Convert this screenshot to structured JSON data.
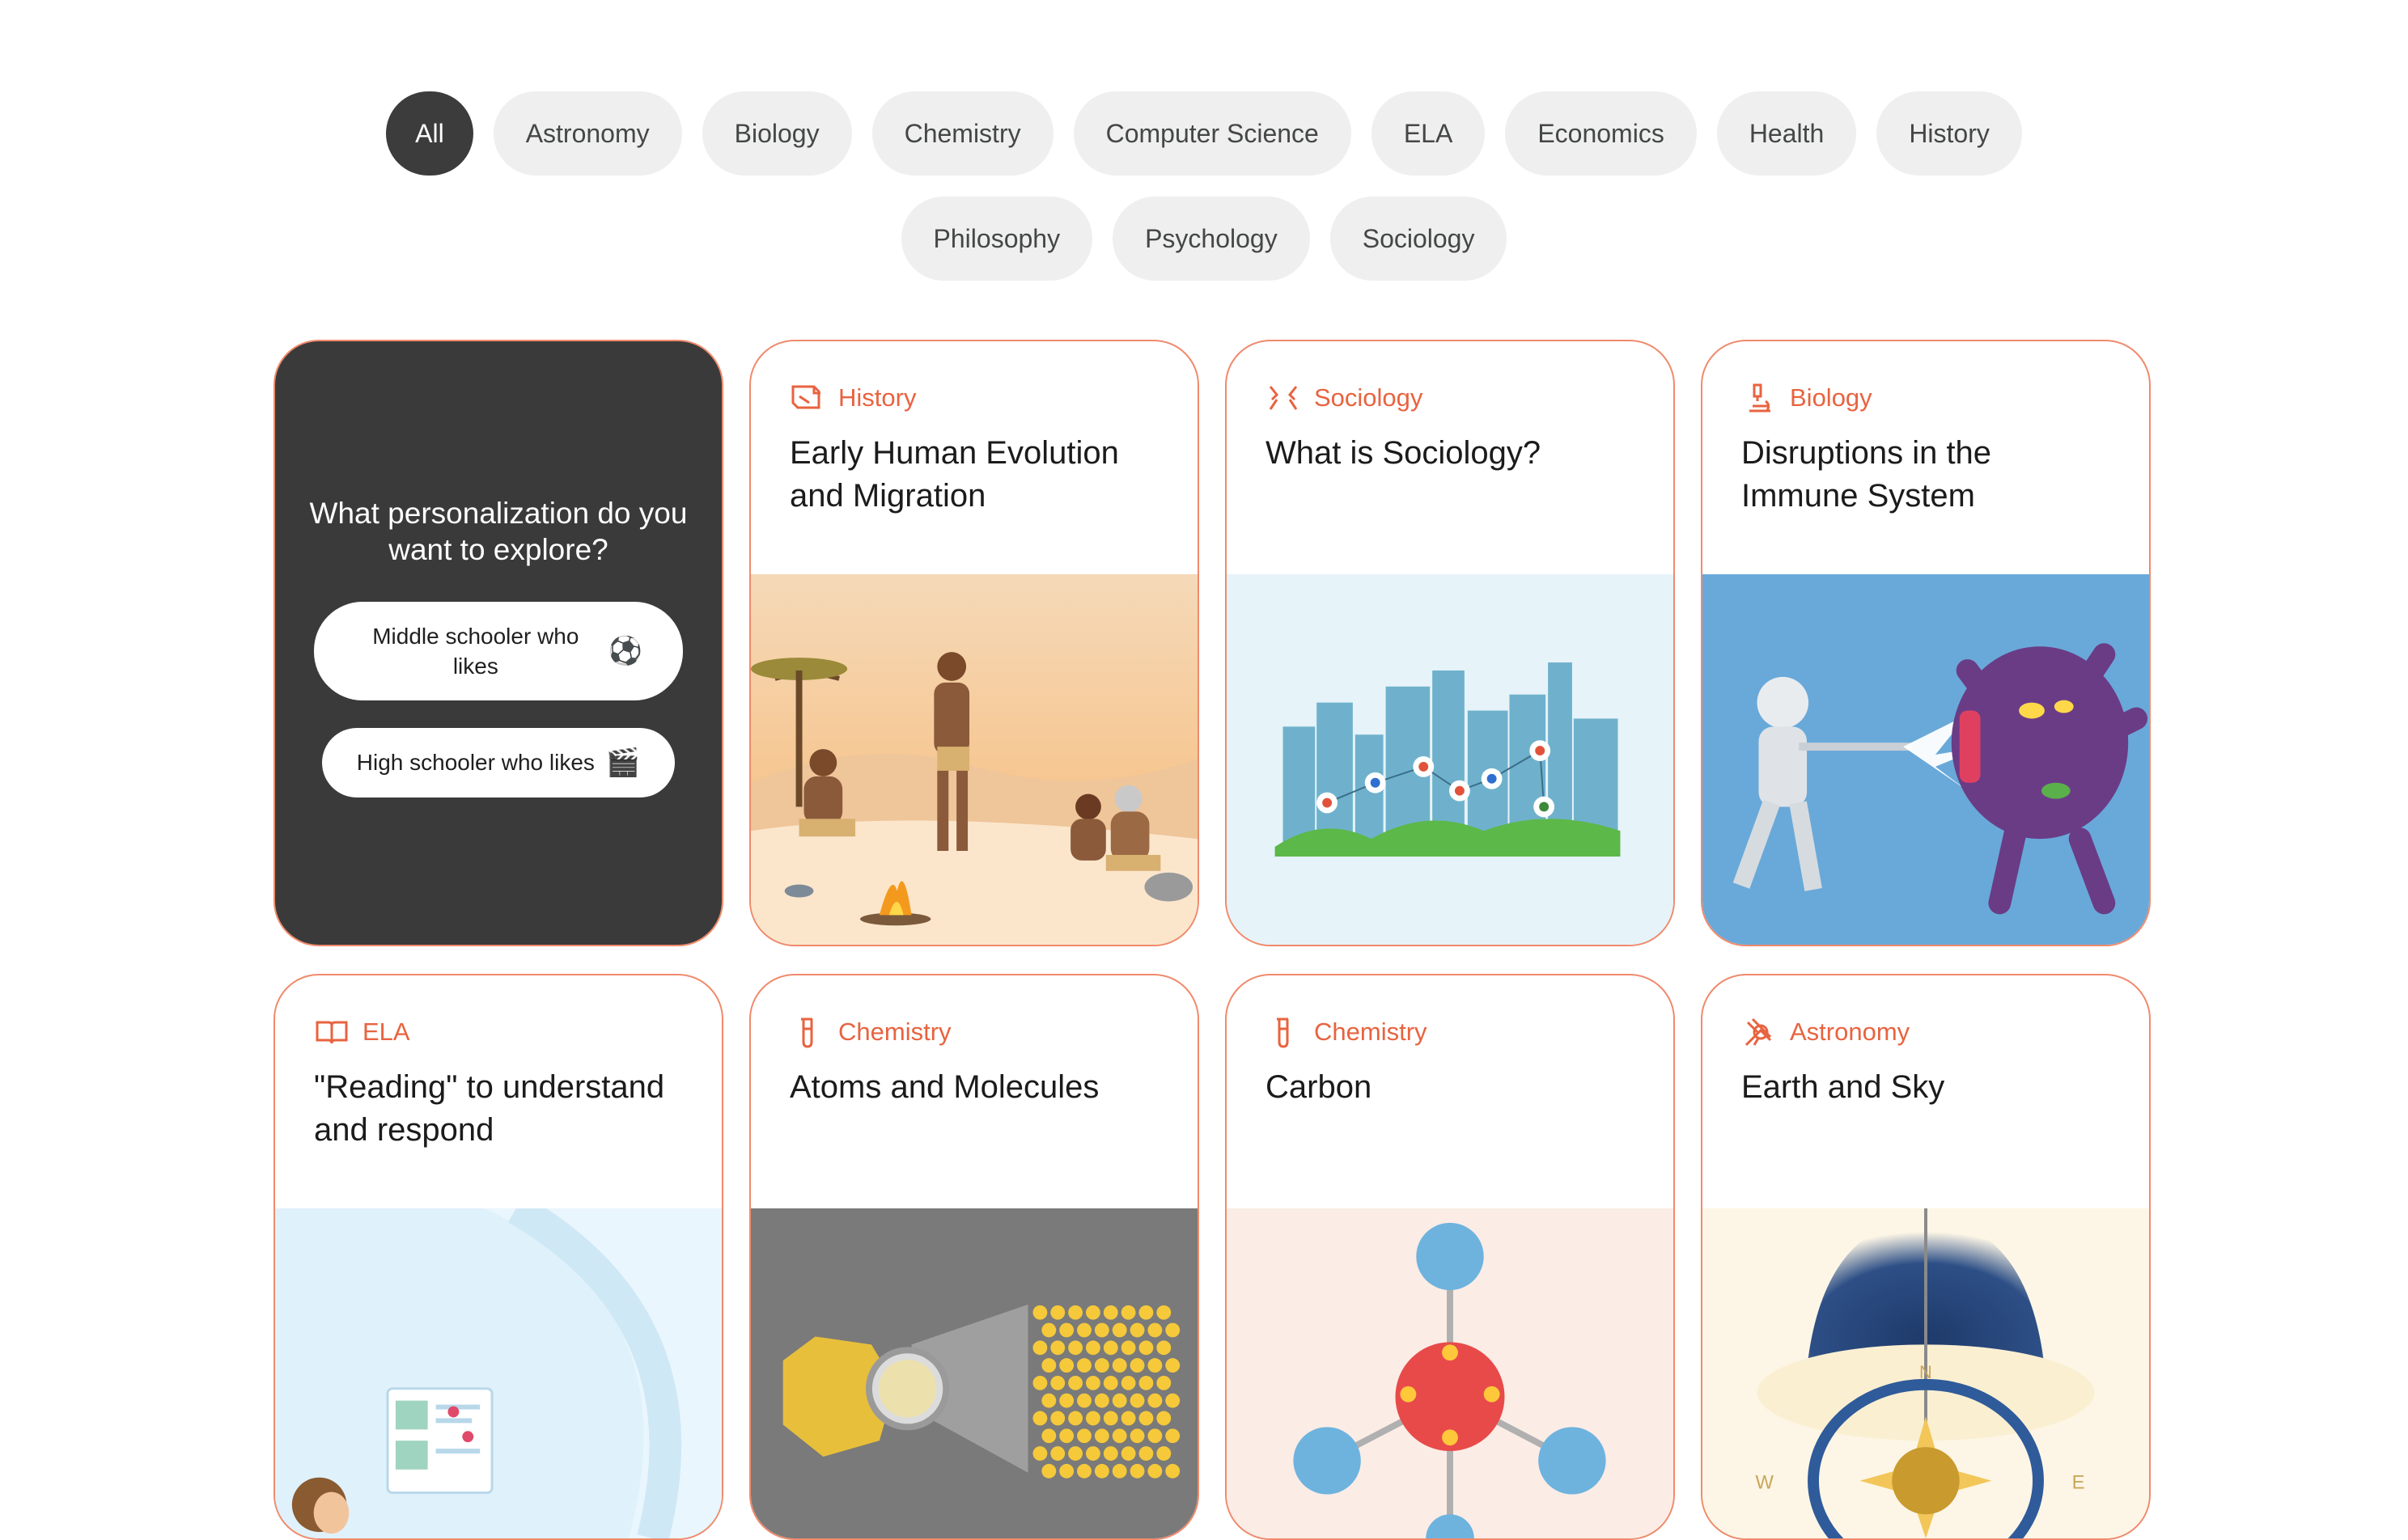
{
  "filters": {
    "row1": [
      "All",
      "Astronomy",
      "Biology",
      "Chemistry",
      "Computer Science",
      "ELA",
      "Economics",
      "Health",
      "History"
    ],
    "row2": [
      "Philosophy",
      "Psychology",
      "Sociology"
    ],
    "active": "All"
  },
  "personalize": {
    "question": "What personalization do you want to explore?",
    "option1": {
      "label": "Middle schooler who likes",
      "emoji": "⚽"
    },
    "option2": {
      "label": "High schooler who likes",
      "emoji": "🎬"
    }
  },
  "cards": [
    {
      "category": "History",
      "category_icon": "history-scroll-icon",
      "title": "Early Human Evolution and Migration"
    },
    {
      "category": "Sociology",
      "category_icon": "sociology-people-icon",
      "title": "What is Sociology?"
    },
    {
      "category": "Biology",
      "category_icon": "microscope-icon",
      "title": "Disruptions in the Immune System"
    },
    {
      "category": "ELA",
      "category_icon": "open-book-icon",
      "title": "\"Reading\" to understand and respond"
    },
    {
      "category": "Chemistry",
      "category_icon": "test-tube-icon",
      "title": "Atoms and Molecules"
    },
    {
      "category": "Chemistry",
      "category_icon": "test-tube-icon",
      "title": "Carbon"
    },
    {
      "category": "Astronomy",
      "category_icon": "telescope-icon",
      "title": "Earth and Sky"
    }
  ],
  "colors": {
    "accent": "#e8633f",
    "card_border": "#f08a6c",
    "chip_bg": "#efefef",
    "chip_active_bg": "#3c3c3c"
  },
  "compass_letters": {
    "n": "N",
    "w": "W",
    "e": "E"
  }
}
